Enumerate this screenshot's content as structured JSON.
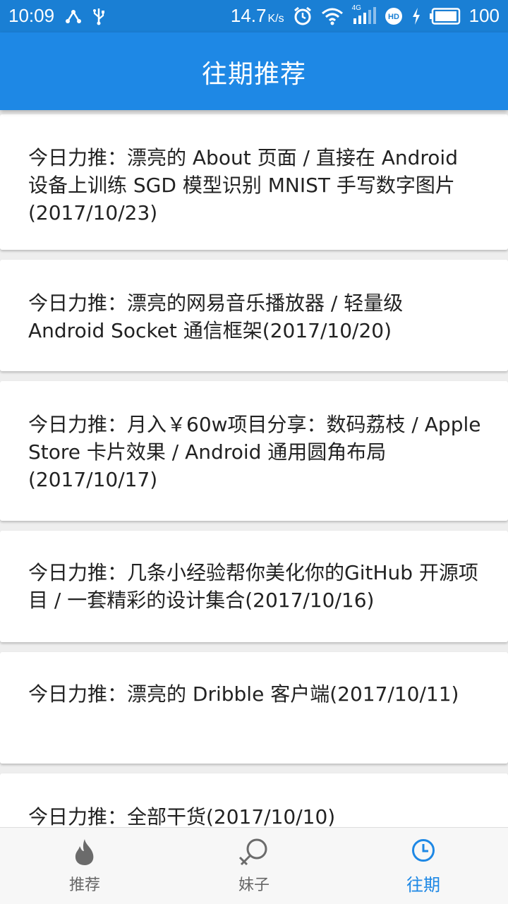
{
  "status_bar": {
    "time": "10:09",
    "speed": "14.7",
    "speed_unit": "K/s",
    "network": "4G",
    "battery": "100",
    "icons": [
      "share-icon",
      "usb-icon",
      "alarm-icon",
      "wifi-icon",
      "signal-icon",
      "hd-icon",
      "charging-icon",
      "battery-icon"
    ]
  },
  "app_bar": {
    "title": "往期推荐"
  },
  "list": {
    "items": [
      {
        "title": "今日力推：漂亮的 About 页面 / 直接在 Android 设备上训练 SGD 模型识别 MNIST 手写数字图片(2017/10/23)"
      },
      {
        "title": "今日力推：漂亮的网易音乐播放器 / 轻量级 Android Socket 通信框架(2017/10/20)"
      },
      {
        "title": "今日力推：月入￥60w项目分享：数码荔枝 / Apple Store 卡片效果 / Android 通用圆角布局(2017/10/17)"
      },
      {
        "title": "今日力推：几条小经验帮你美化你的GitHub 开源项目 / 一套精彩的设计集合(2017/10/16)"
      },
      {
        "title": "今日力推：漂亮的 Dribble 客户端(2017/10/11)"
      },
      {
        "title": "今日力推：全部干货(2017/10/10)"
      }
    ]
  },
  "bottom_nav": {
    "tabs": [
      {
        "label": "推荐",
        "icon": "flame-icon",
        "active": false
      },
      {
        "label": "妹子",
        "icon": "female-symbol-icon",
        "active": false
      },
      {
        "label": "往期",
        "icon": "clock-icon",
        "active": true
      }
    ]
  },
  "colors": {
    "primary": "#1e88e5",
    "status_bar": "#1a7fd4",
    "active_tab": "#1e88e5",
    "inactive_tab": "#666666"
  }
}
